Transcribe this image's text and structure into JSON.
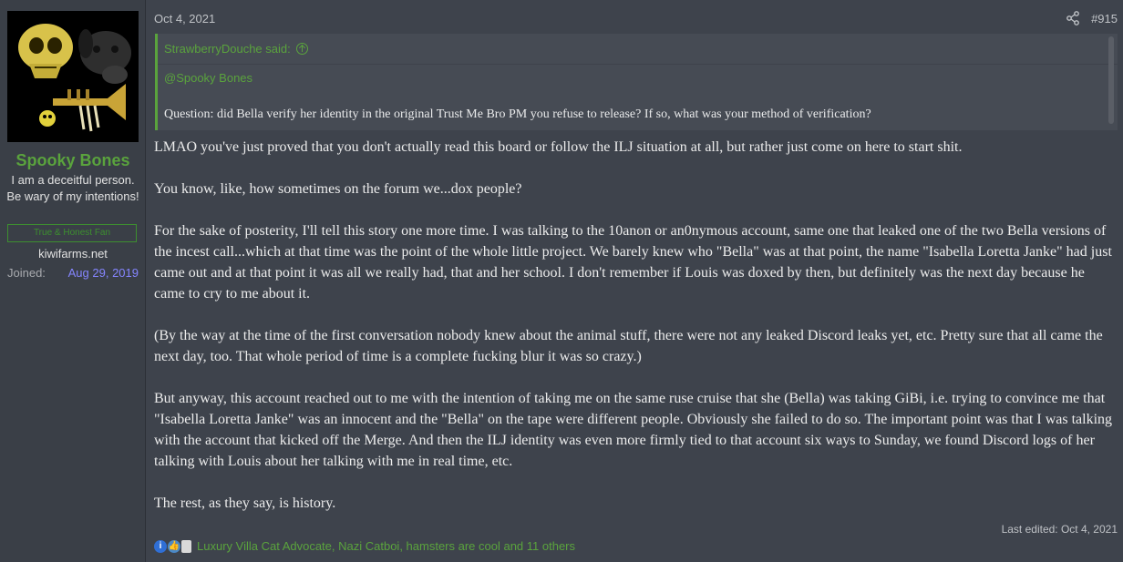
{
  "user": {
    "name": "Spooky Bones",
    "title": "I am a deceitful person. Be wary of my intentions!",
    "banner": "True & Honest Fan",
    "site": "kiwifarms.net",
    "joined_label": "Joined:",
    "joined_value": "Aug 29, 2019"
  },
  "post": {
    "date": "Oct 4, 2021",
    "number": "#915",
    "share_icon": "share-icon",
    "quote": {
      "author": "StrawberryDouche said:",
      "mention": "@Spooky Bones",
      "text": "Question: did Bella verify her identity in the original Trust Me Bro PM you refuse to release? If so, what was your method of verification?"
    },
    "paragraphs": [
      "LMAO you've just proved that you don't actually read this board or follow the ILJ situation at all, but rather just come on here to start shit.",
      "You know, like, how sometimes on the forum we...dox people?",
      "For the sake of posterity, I'll tell this story one more time. I was talking to the 10anon or an0nymous account, same one that leaked one of the two Bella versions of the incest call...which at that time was the point of the whole little project. We barely knew who \"Bella\" was at that point, the name \"Isabella Loretta Janke\" had just came out and at that point it was all we really had, that and her school. I don't remember if Louis was doxed by then, but definitely was the next day because he came to cry to me about it.",
      "(By the way at the time of the first conversation nobody knew about the animal stuff, there were not any leaked Discord leaks yet, etc. Pretty sure that all came the next day, too. That whole period of time is a complete fucking blur it was so crazy.)",
      "But anyway, this account reached out to me with the intention of taking me on the same ruse cruise that she (Bella) was taking GiBi, i.e. trying to convince me that \"Isabella Loretta Janke\" was an innocent and the \"Bella\" on the tape were different people. Obviously she failed to do so. The important point was that I was talking with the account that kicked off the Merge. And then the ILJ identity was even more firmly tied to that account six ways to Sunday, we found Discord logs of her talking with Louis about her talking with me in real time, etc.",
      "The rest, as they say, is history."
    ],
    "last_edited": "Last edited: Oct 4, 2021",
    "reactions_text": "Luxury Villa Cat Advocate, Nazi Catboi, hamsters are cool and 11 others"
  }
}
